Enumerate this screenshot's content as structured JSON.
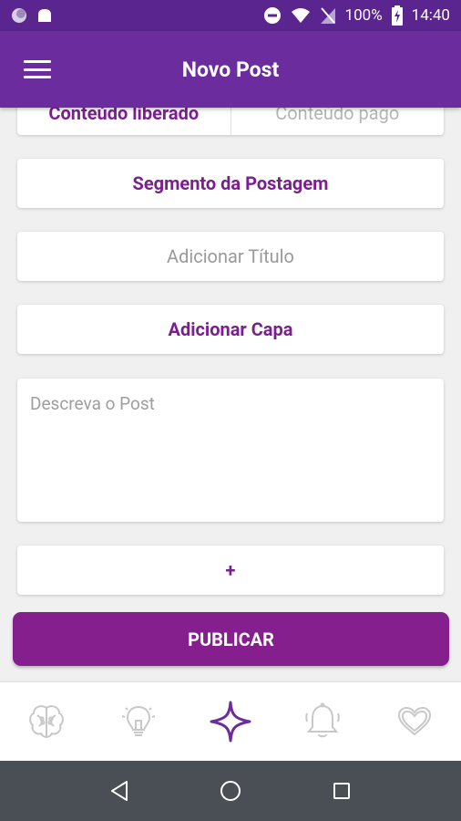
{
  "status_bar": {
    "battery": "100%",
    "time": "14:40"
  },
  "app_bar": {
    "title": "Novo Post"
  },
  "content_toggle": {
    "free_label": "Conteúdo liberado",
    "paid_label": "Conteúdo pago",
    "selected": "free"
  },
  "form": {
    "segment_label": "Segmento da Postagem",
    "title_placeholder": "Adicionar Título",
    "cover_label": "Adicionar Capa",
    "description_placeholder": "Descreva o Post",
    "add_label": "+"
  },
  "publish_label": "PUBLICAR",
  "tab_bar": {
    "tabs": [
      {
        "icon": "brain-icon",
        "active": false
      },
      {
        "icon": "lightbulb-icon",
        "active": false
      },
      {
        "icon": "sparkle-icon",
        "active": true
      },
      {
        "icon": "bell-icon",
        "active": false
      },
      {
        "icon": "heart-icon",
        "active": false
      }
    ]
  },
  "colors": {
    "primary": "#6b2d9e",
    "status_bar": "#5b2590",
    "accent": "#7b1f8f",
    "publish_button": "#851f8e",
    "inactive_icon": "#c8c8c8"
  }
}
